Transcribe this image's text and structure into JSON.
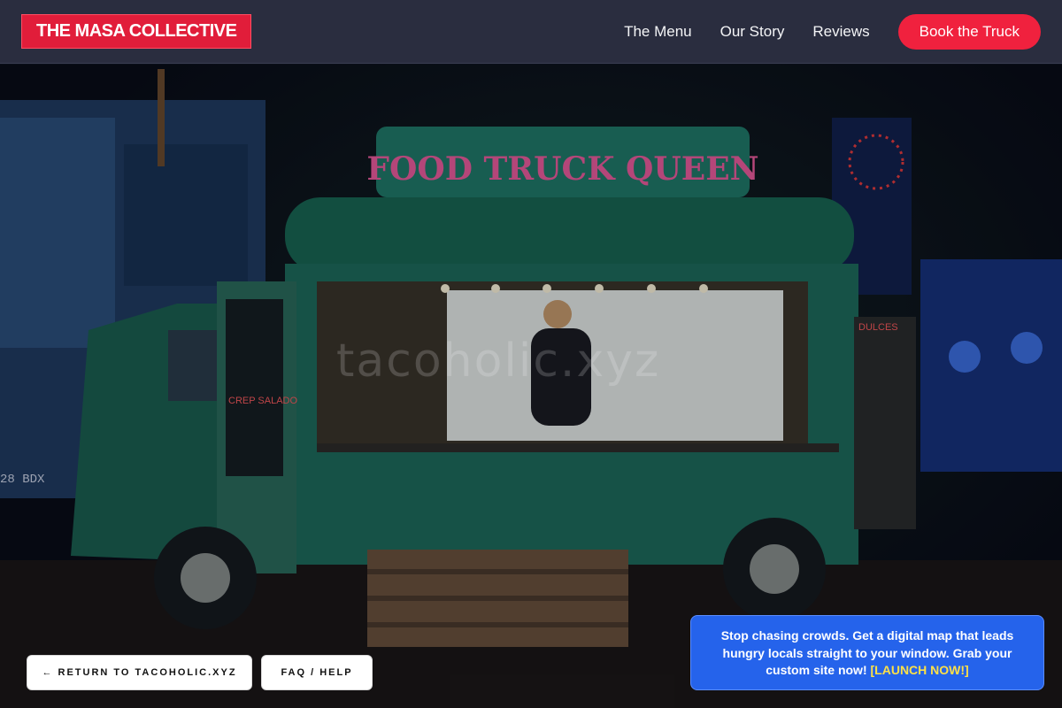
{
  "header": {
    "logo": "THE MASA COLLECTIVE",
    "nav": [
      "The Menu",
      "Our Story",
      "Reviews"
    ],
    "cta": "Book the Truck"
  },
  "hero": {
    "truck_sign": "FOOD TRUCK QUEEN",
    "watermark": "tacoholic.xyz",
    "left_board": "CREP SALADO",
    "right_board": "DULCES",
    "plate": "28 BDX"
  },
  "buttons": {
    "return": "← RETURN TO TACOHOLIC.XYZ",
    "faq": "FAQ / HELP"
  },
  "promo": {
    "text": "Stop chasing crowds. Get a digital map that leads hungry locals straight to your window. Grab your custom site now!",
    "link": "[LAUNCH NOW!]"
  },
  "colors": {
    "header_bg": "#2a2d3f",
    "brand_red": "#e11d3a",
    "promo_blue": "#2563eb",
    "promo_link": "#fde047",
    "truck_teal": "#1d6b58"
  }
}
